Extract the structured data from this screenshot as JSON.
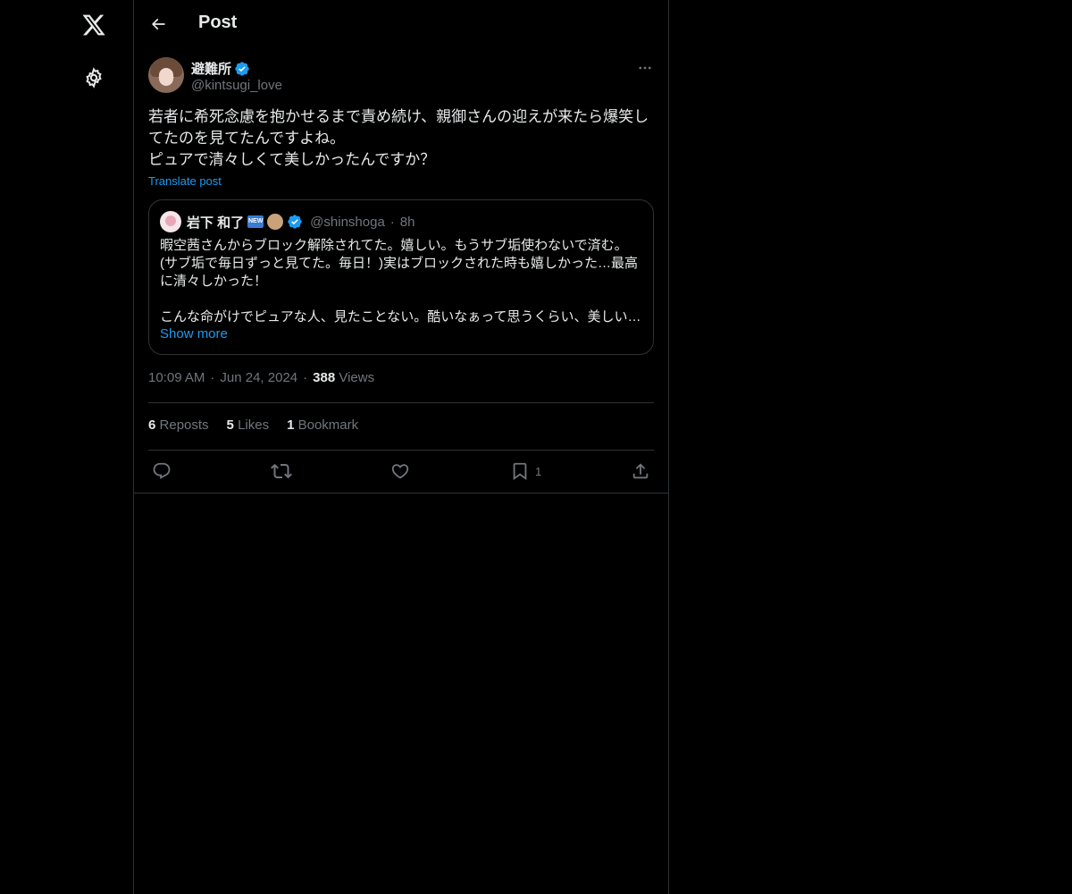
{
  "nav": {
    "logo_icon": "x-logo-icon",
    "settings_icon": "gear-icon"
  },
  "header": {
    "title": "Post"
  },
  "post": {
    "author_name": "避難所",
    "author_handle": "@kintsugi_love",
    "text": "若者に希死念慮を抱かせるまで責め続け、親御さんの迎えが来たら爆笑してたのを見てたんですよね。\nピュアで清々しくて美しかったんですか？",
    "translate_label": "Translate post",
    "time": "10:09 AM",
    "date": "Jun 24, 2024",
    "views_count": "388",
    "views_label": "Views"
  },
  "quote": {
    "name": "岩下 和了",
    "handle": "@shinshoga",
    "time": "8h",
    "text": "暇空茜さんからブロック解除されてた。嬉しい。もうサブ垢使わないで済む。(サブ垢で毎日ずっと見てた。毎日！)実はブロックされた時も嬉しかった…最高に清々しかった！\n\nこんな命がけでピュアな人、見たことない。酷いなぁって思うくらい、美しい…",
    "show_more": "Show more",
    "badge": "NEW"
  },
  "stats": {
    "reposts_count": "6",
    "reposts_label": "Reposts",
    "likes_count": "5",
    "likes_label": "Likes",
    "bookmarks_count": "1",
    "bookmarks_label": "Bookmark"
  },
  "actions": {
    "bookmark_count": "1"
  },
  "colors": {
    "accent": "#1d9bf0",
    "background": "#000000",
    "border": "#2f3336",
    "muted": "#71767b",
    "text": "#e7e9ea"
  }
}
